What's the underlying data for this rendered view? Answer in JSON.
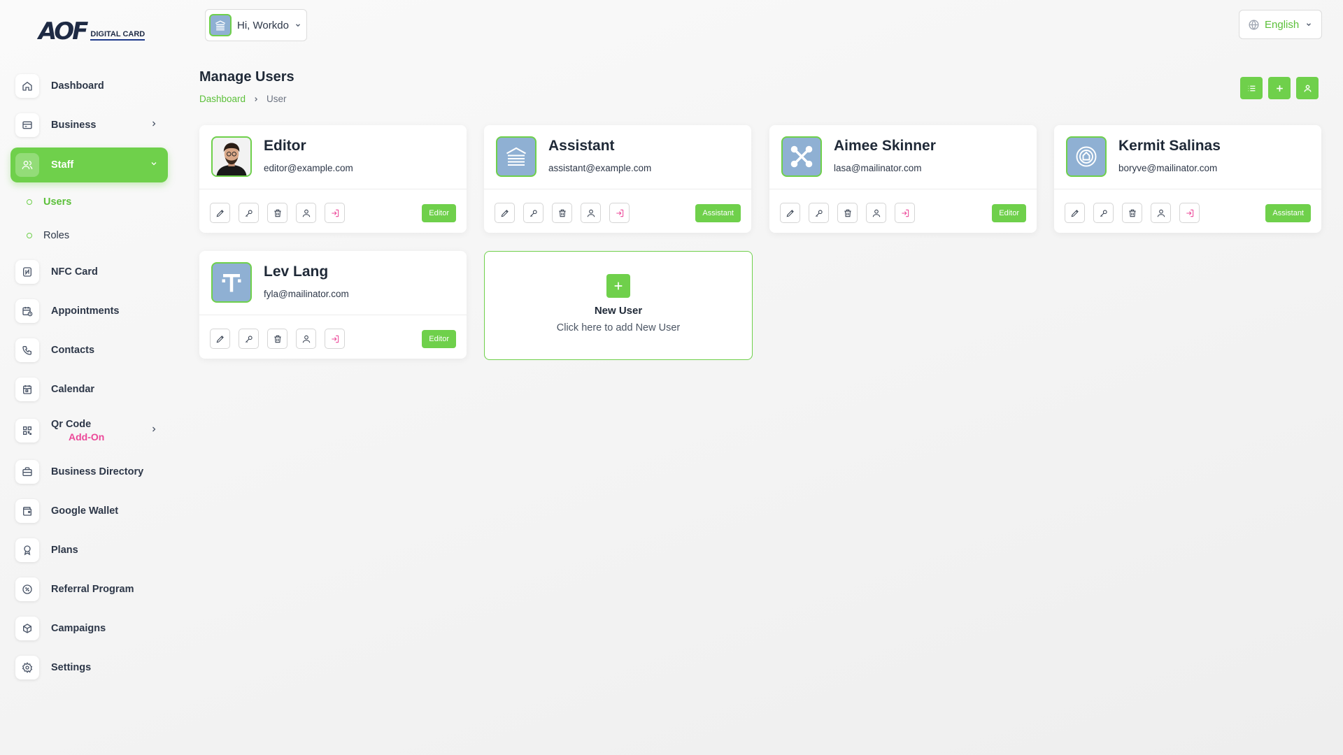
{
  "brand": {
    "mark": "AOF",
    "text": "DIGITAL CARD"
  },
  "colors": {
    "accent": "#6fd04b",
    "addon": "#ec4899",
    "avatar_bg": "#8fb0d3",
    "danger": "#ec4899"
  },
  "topbar": {
    "greeting": "Hi, Workdo",
    "language": "English"
  },
  "sidebar": {
    "items": [
      {
        "label": "Dashboard",
        "icon": "home-icon"
      },
      {
        "label": "Business",
        "icon": "business-card-icon"
      },
      {
        "label": "Staff",
        "icon": "users-icon"
      },
      {
        "label": "NFC Card",
        "icon": "nfc-icon"
      },
      {
        "label": "Appointments",
        "icon": "calendar-clock-icon"
      },
      {
        "label": "Contacts",
        "icon": "phone-icon"
      },
      {
        "label": "Calendar",
        "icon": "calendar-icon"
      },
      {
        "label": "Qr Code",
        "icon": "qrcode-icon",
        "badge": "Add-On"
      },
      {
        "label": "Business Directory",
        "icon": "briefcase-icon"
      },
      {
        "label": "Google Wallet",
        "icon": "wallet-icon"
      },
      {
        "label": "Plans",
        "icon": "award-icon"
      },
      {
        "label": "Referral Program",
        "icon": "discount-icon"
      },
      {
        "label": "Campaigns",
        "icon": "box-icon"
      },
      {
        "label": "Settings",
        "icon": "gear-icon"
      }
    ],
    "staff_sub": [
      {
        "label": "Users"
      },
      {
        "label": "Roles"
      }
    ]
  },
  "header": {
    "title": "Manage Users",
    "breadcrumb": [
      "Dashboard",
      "User"
    ]
  },
  "users": [
    {
      "name": "Editor",
      "email": "editor@example.com",
      "role": "Editor",
      "avatar": "photo"
    },
    {
      "name": "Assistant",
      "email": "assistant@example.com",
      "role": "Assistant",
      "avatar": "building"
    },
    {
      "name": "Aimee Skinner",
      "email": "lasa@mailinator.com",
      "role": "Editor",
      "avatar": "joomla"
    },
    {
      "name": "Kermit Salinas",
      "email": "boryve@mailinator.com",
      "role": "Assistant",
      "avatar": "badge"
    },
    {
      "name": "Lev Lang",
      "email": "fyla@mailinator.com",
      "role": "Editor",
      "avatar": "t-logo"
    }
  ],
  "new_user": {
    "title": "New User",
    "subtitle": "Click here to add New User"
  }
}
